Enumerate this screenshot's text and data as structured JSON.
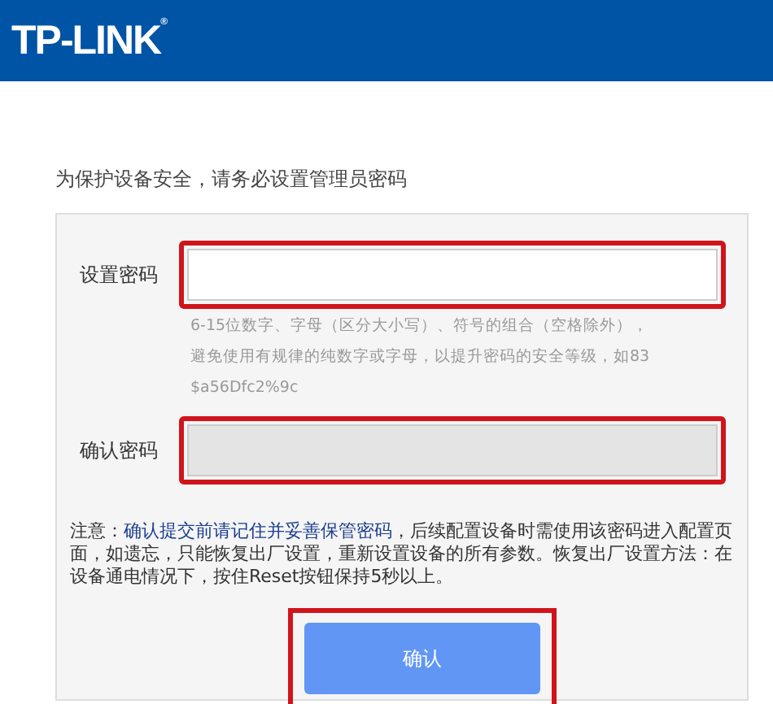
{
  "header": {
    "logo": "TP-LINK",
    "logo_mark": "®"
  },
  "intro": "为保护设备安全，请务必设置管理员密码",
  "fields": [
    {
      "label": "设置密码",
      "disabled": false,
      "highlighted": true,
      "hint": [
        "6-15位数字、字母（区分大小写）、符号的组合（空格除外），",
        "避免使用有规律的纯数字或字母，以提升密码的安全等级，如83",
        "$a56Dfc2%9c"
      ]
    },
    {
      "label": "确认密码",
      "disabled": true,
      "highlighted": true
    }
  ],
  "note": {
    "prefix": "注意：",
    "emphasis": "确认提交前请记住并妥善保管密码",
    "rest": "，后续配置设备时需使用该密码进入配置页面，如遗忘，只能恢复出厂设置，重新设置设备的所有参数。恢复出厂设置方法：在设备通电情况下，按住Reset按钮保持5秒以上。"
  },
  "confirm_button": {
    "label": "确认",
    "highlighted": true
  }
}
